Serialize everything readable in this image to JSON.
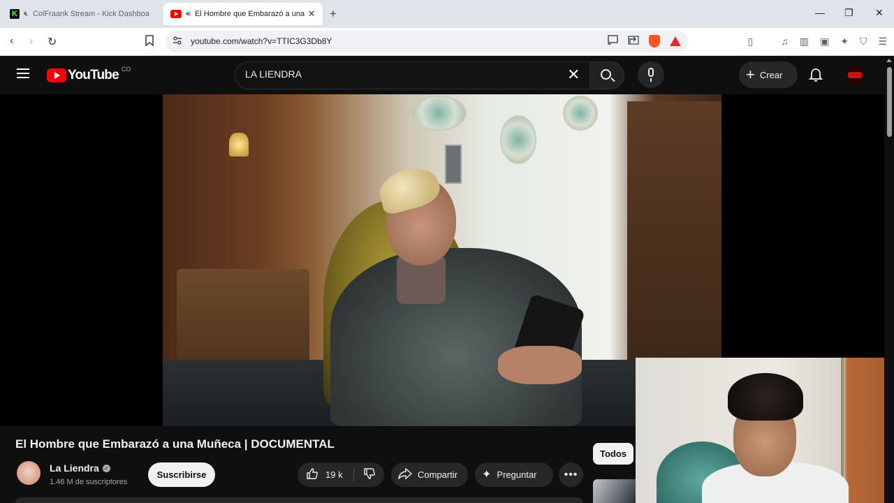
{
  "browser": {
    "tabs": [
      {
        "title": "ColFraank Stream - Kick Dashboa",
        "favicon": "kick-icon",
        "favicon_letter": "K",
        "audio": "muted",
        "active": false
      },
      {
        "title": "El Hombre que Embarazó a una Muñeca | DOCUMENTAL",
        "favicon": "youtube-icon",
        "audio": "playing",
        "active": true
      }
    ],
    "new_tab_glyph": "+",
    "close_glyph": "✕",
    "window_controls": {
      "minimize": "—",
      "restore": "❐",
      "close": "✕"
    },
    "nav": {
      "back": "‹",
      "forward": "›",
      "reload": "↻",
      "bookmark": "🔖"
    },
    "url": "youtube.com/watch?v=TTIC3G3Db8Y",
    "omnibox_icons": [
      "cast-icon",
      "share-icon",
      "brave-shields-icon",
      "brave-rewards-icon"
    ],
    "right_icons": {
      "sidebar": "▯",
      "music": "♫",
      "panel": "▥",
      "wallet": "▣",
      "leo": "✦",
      "vpn": "⛉",
      "menu": "☰"
    }
  },
  "youtube": {
    "logo_text": "YouTube",
    "country_code": "CO",
    "search_value": "LA LIENDRA",
    "search_clear": "✕",
    "create_label": "Crear",
    "create_plus": "+",
    "video": {
      "title": "El Hombre que Embarazó a una Muñeca | DOCUMENTAL"
    },
    "channel": {
      "name": "La Liendra",
      "verified": "✓",
      "subscribers": "1.46 M de suscriptores",
      "subscribe_label": "Suscribirse"
    },
    "actions": {
      "like_count": "19 k",
      "like_glyph": "👍︎",
      "dislike_glyph": "👎︎",
      "share_glyph": "↪",
      "share_label": "Compartir",
      "ask_glyph": "✦",
      "ask_label": "Preguntar",
      "more_glyph": "•••"
    },
    "chips": {
      "all": "Todos"
    }
  },
  "colors": {
    "accent": "#ff0000",
    "background": "#0f0f0f",
    "pill": "#272727",
    "text": "#f1f1f1"
  }
}
